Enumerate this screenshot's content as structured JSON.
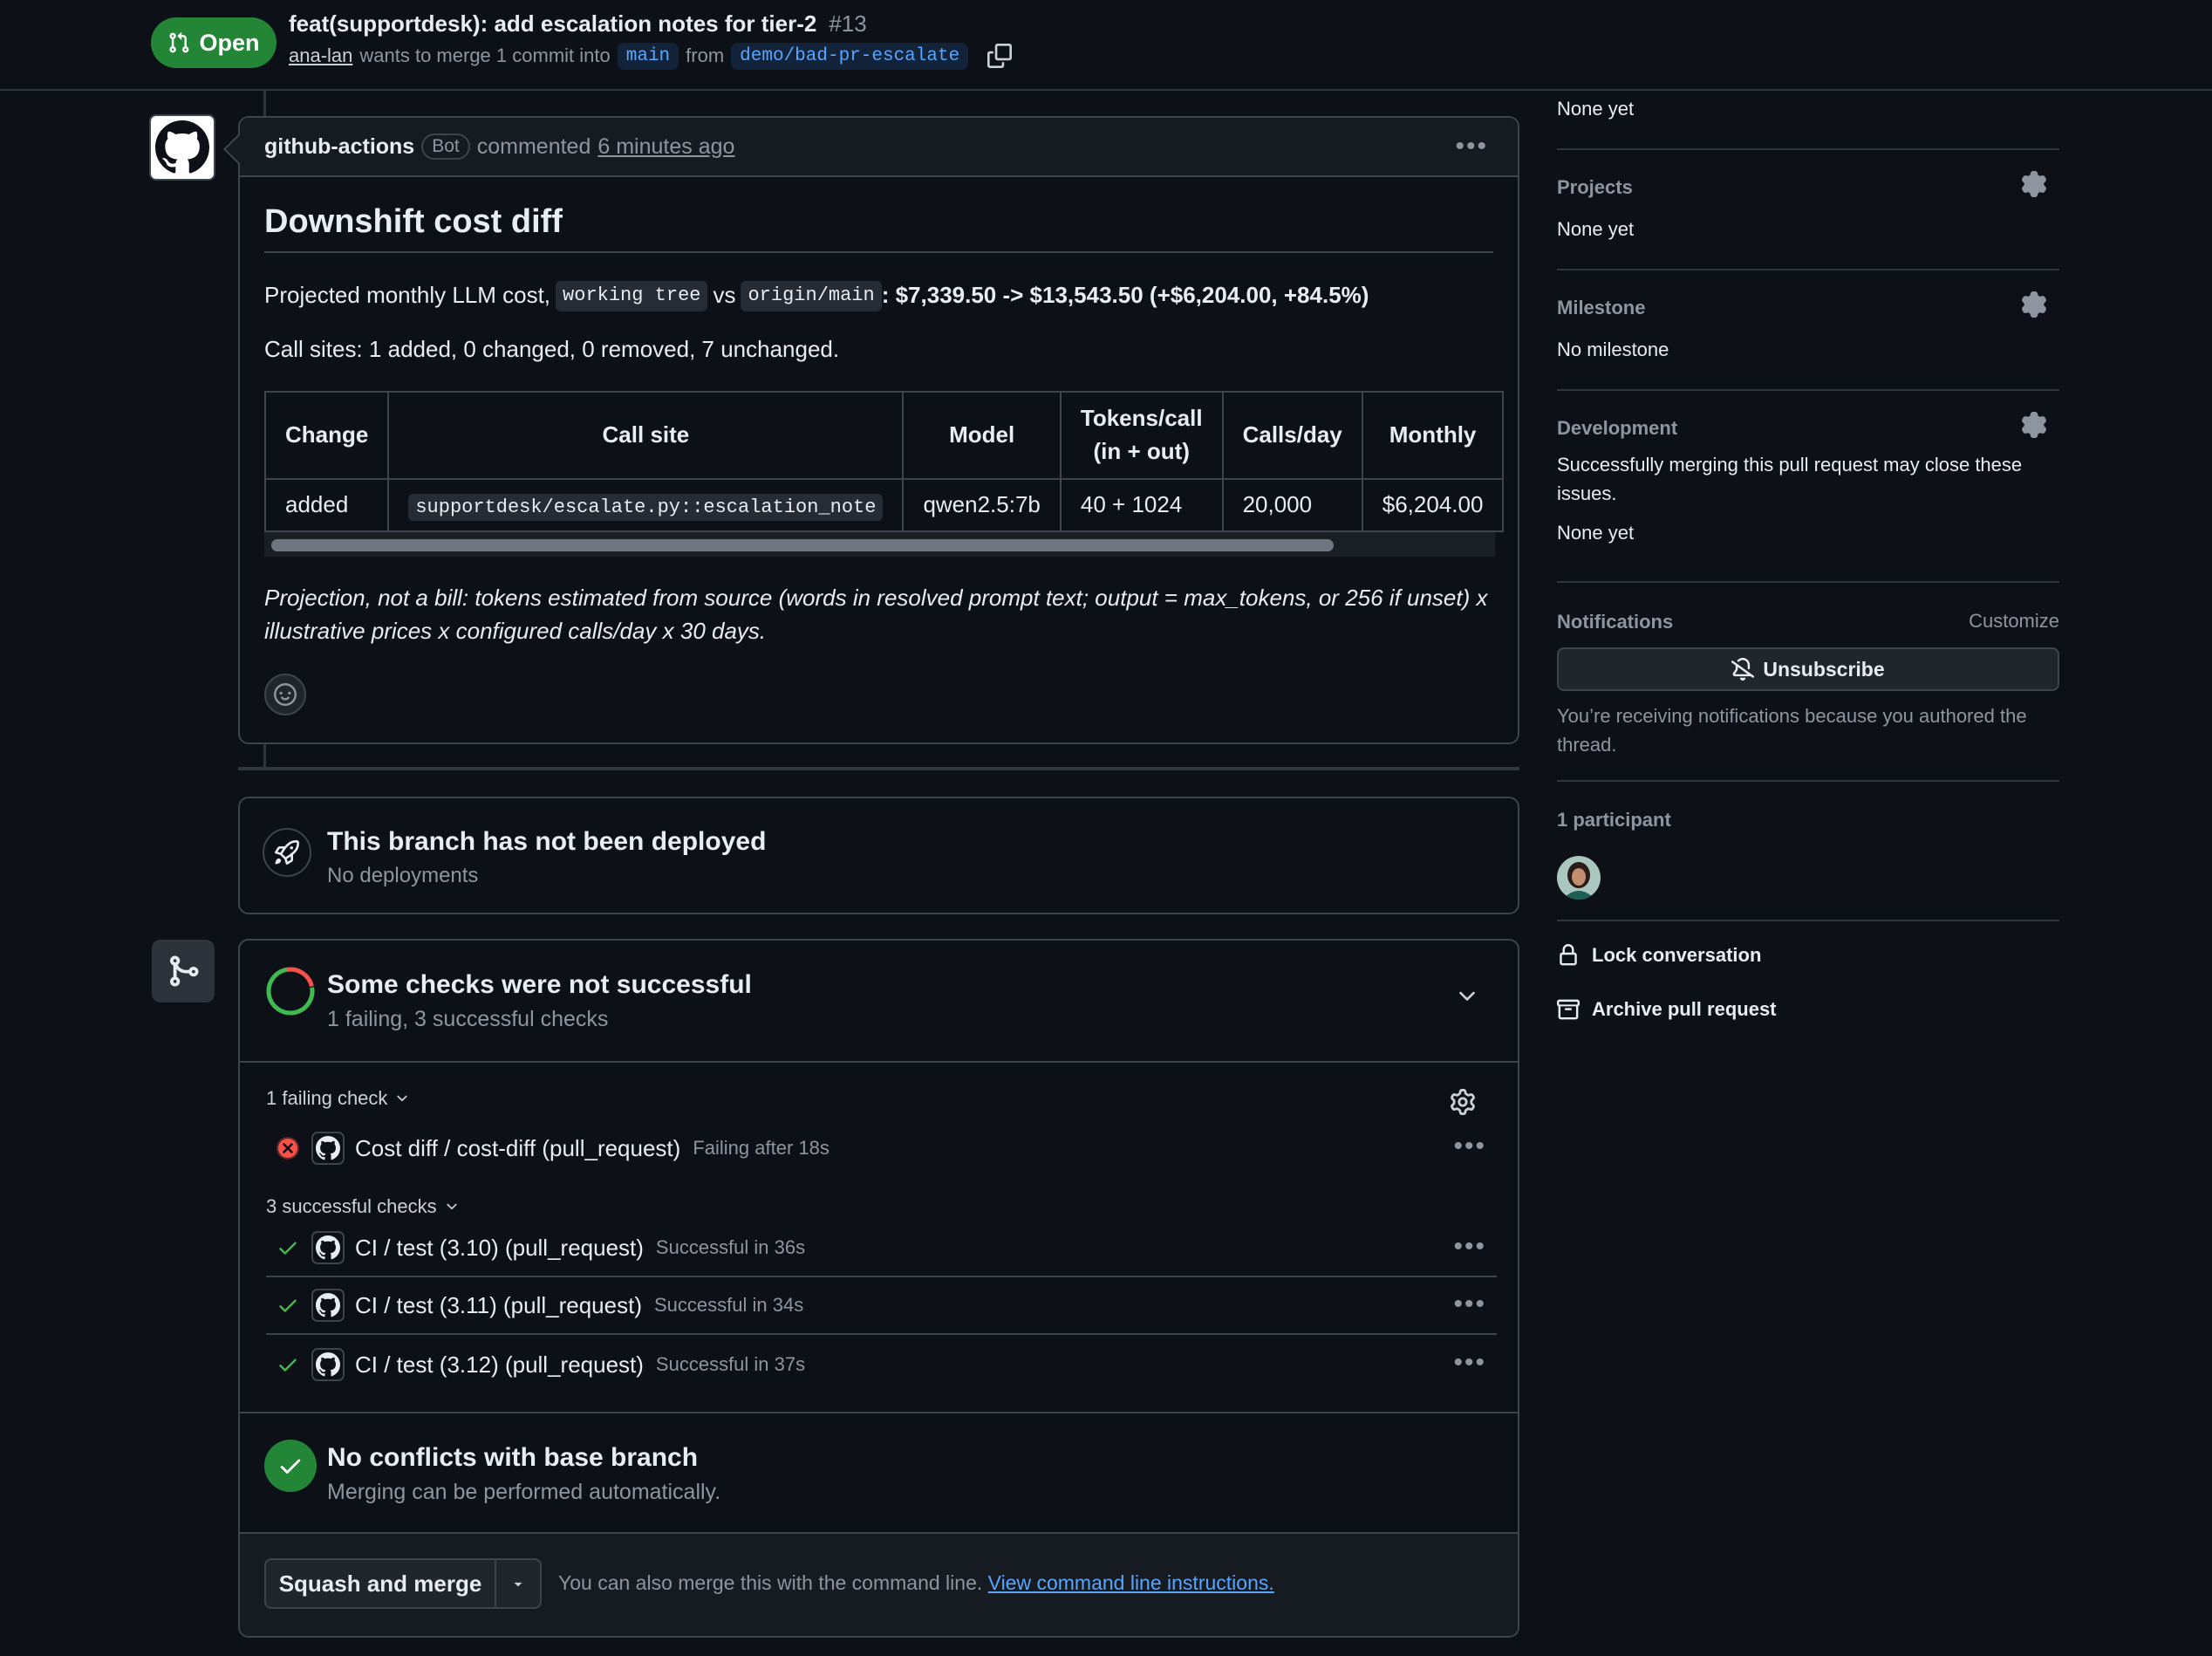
{
  "header": {
    "state": "Open",
    "title": "feat(supportdesk): add escalation notes for tier-2",
    "number": "#13",
    "author": "ana-lan",
    "merge_text": "wants to merge 1 commit into",
    "base_branch": "main",
    "from_text": "from",
    "head_branch": "demo/bad-pr-escalate"
  },
  "comment": {
    "author": "github-actions",
    "author_badge": "Bot",
    "action": "commented",
    "time": "6 minutes ago",
    "heading": "Downshift cost diff",
    "proj_prefix": "Projected monthly LLM cost,",
    "code_a": "working tree",
    "vs": "vs",
    "code_b": "origin/main",
    "proj_values": ": $7,339.50 -> $13,543.50 (+$6,204.00, +84.5%)",
    "call_sites": "Call sites: 1 added, 0 changed, 0 removed, 7 unchanged.",
    "table": {
      "headers": [
        "Change",
        "Call site",
        "Model",
        "Tokens/call",
        "(in + out)",
        "Calls/day",
        "Monthly"
      ],
      "row": [
        "added",
        "supportdesk/escalate.py::escalation_note",
        "qwen2.5:7b",
        "40 + 1024",
        "20,000",
        "$6,204.00"
      ]
    },
    "note": "Projection, not a bill: tokens estimated from source (words in resolved prompt text; output = max_tokens, or 256 if unset) x illustrative prices x configured calls/day x 30 days."
  },
  "deploy": {
    "title": "This branch has not been deployed",
    "subtitle": "No deployments"
  },
  "checks": {
    "title": "Some checks were not successful",
    "subtitle": "1 failing, 3 successful checks",
    "failing_label": "1 failing check",
    "successful_label": "3 successful checks",
    "failing": [
      {
        "name": "Cost diff / cost-diff (pull_request)",
        "duration": "Failing after 18s"
      }
    ],
    "successful": [
      {
        "name": "CI / test (3.10) (pull_request)",
        "duration": "Successful in 36s"
      },
      {
        "name": "CI / test (3.11) (pull_request)",
        "duration": "Successful in 34s"
      },
      {
        "name": "CI / test (3.12) (pull_request)",
        "duration": "Successful in 37s"
      }
    ],
    "colors": {
      "fail": "#f85149",
      "success": "#3fb950"
    }
  },
  "conflicts": {
    "title": "No conflicts with base branch",
    "subtitle": "Merging can be performed automatically."
  },
  "merge": {
    "button": "Squash and merge",
    "cli_text": "You can also merge this with the command line.",
    "cli_link": "View command line instructions."
  },
  "sidebar": {
    "top_value": "None yet",
    "projects": {
      "title": "Projects",
      "value": "None yet"
    },
    "milestone": {
      "title": "Milestone",
      "value": "No milestone"
    },
    "development": {
      "title": "Development",
      "description": "Successfully merging this pull request may close these issues.",
      "value": "None yet"
    },
    "notifications": {
      "title": "Notifications",
      "customize": "Customize",
      "button": "Unsubscribe",
      "reason": "You’re receiving notifications because you authored the thread."
    },
    "participants": {
      "title": "1 participant"
    },
    "lock": "Lock conversation",
    "archive": "Archive pull request"
  },
  "icons": [
    "git-pull-request-icon",
    "copy-icon",
    "github-logo-icon",
    "kebab-icon",
    "smiley-icon",
    "rocket-icon",
    "git-merge-icon",
    "chevron-down-icon",
    "gear-icon",
    "x-circle-icon",
    "check-icon",
    "bell-slash-icon",
    "lock-icon",
    "archive-icon"
  ],
  "accent": "#238636"
}
